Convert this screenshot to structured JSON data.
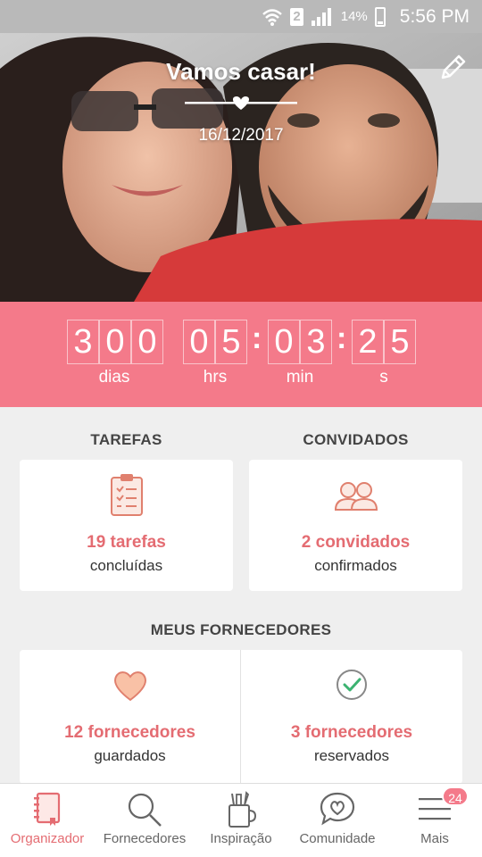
{
  "status_bar": {
    "sim": "2",
    "battery": "14%",
    "time": "5:56 PM"
  },
  "hero": {
    "title": "Vamos casar!",
    "date": "16/12/2017"
  },
  "countdown": {
    "days": [
      "3",
      "0",
      "0"
    ],
    "hours": [
      "0",
      "5"
    ],
    "minutes": [
      "0",
      "3"
    ],
    "seconds": [
      "2",
      "5"
    ],
    "labels": {
      "days": "dias",
      "hours": "hrs",
      "minutes": "min",
      "seconds": "s"
    }
  },
  "tasks": {
    "heading": "TAREFAS",
    "value": "19 tarefas",
    "sub": "concluídas"
  },
  "guests": {
    "heading": "CONVIDADOS",
    "value": "2 convidados",
    "sub": "confirmados"
  },
  "vendors": {
    "heading": "MEUS FORNECEDORES",
    "saved": {
      "value": "12 fornecedores",
      "sub": "guardados"
    },
    "booked": {
      "value": "3 fornecedores",
      "sub": "reservados"
    }
  },
  "nav": {
    "items": [
      {
        "label": "Organizador",
        "icon": "planner-icon"
      },
      {
        "label": "Fornecedores",
        "icon": "search-icon"
      },
      {
        "label": "Inspiração",
        "icon": "inspiration-icon"
      },
      {
        "label": "Comunidade",
        "icon": "chat-heart-icon"
      },
      {
        "label": "Mais",
        "icon": "menu-icon"
      }
    ],
    "badge": "24",
    "active_color": "#e46c72"
  },
  "colors": {
    "accent": "#f47a8a",
    "accent_text": "#e46c72"
  }
}
